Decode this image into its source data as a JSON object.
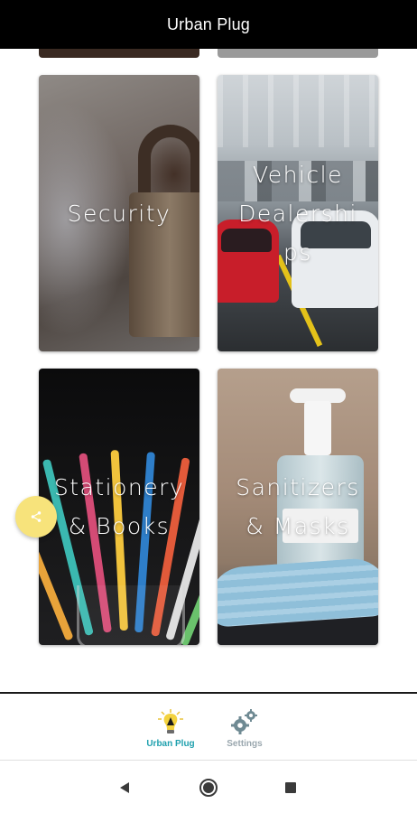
{
  "app_bar": {
    "title": "Urban Plug"
  },
  "categories": [
    {
      "label": "Security",
      "image": "padlock-photo"
    },
    {
      "label": "Vehicle\nDealerships",
      "display_label": "Vehicle\nDealershi\nps",
      "image": "car-dealership-photo"
    },
    {
      "label": "Stationery\n& Books",
      "image": "pens-jar-photo"
    },
    {
      "label": "Sanitizers\n& Masks",
      "image": "sanitizer-mask-photo"
    }
  ],
  "share_button": {
    "icon": "share-icon",
    "color": "#f7e37b"
  },
  "bottom_nav": {
    "items": [
      {
        "label": "Urban Plug",
        "icon": "urban-plug-bulb-icon",
        "active": true,
        "color": "#1fa0ae"
      },
      {
        "label": "Settings",
        "icon": "gears-icon",
        "active": false,
        "color": "#9aa7ae"
      }
    ]
  },
  "system_nav": {
    "back": "back-icon",
    "home": "home-circle-icon",
    "recents": "recents-square-icon"
  }
}
